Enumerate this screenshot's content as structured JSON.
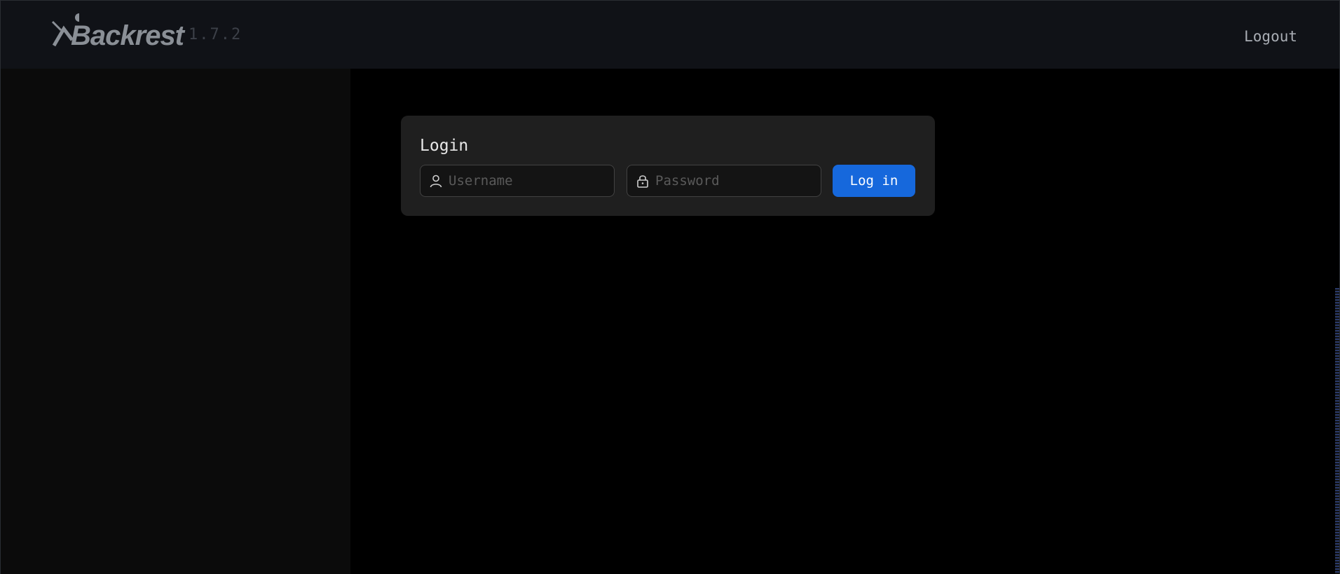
{
  "header": {
    "logo_text": "Backrest",
    "version": "1.7.2",
    "logout_label": "Logout"
  },
  "login": {
    "title": "Login",
    "username": {
      "placeholder": "Username",
      "value": ""
    },
    "password": {
      "placeholder": "Password",
      "value": ""
    },
    "submit_label": "Log in"
  },
  "icons": {
    "logo": "backrest-logo-icon",
    "username": "user-icon",
    "password": "lock-icon"
  },
  "colors": {
    "header_bg": "#101217",
    "sidebar_bg": "#0b0b0b",
    "main_bg": "#000000",
    "card_bg": "#1f1f1f",
    "primary": "#1668dc"
  }
}
